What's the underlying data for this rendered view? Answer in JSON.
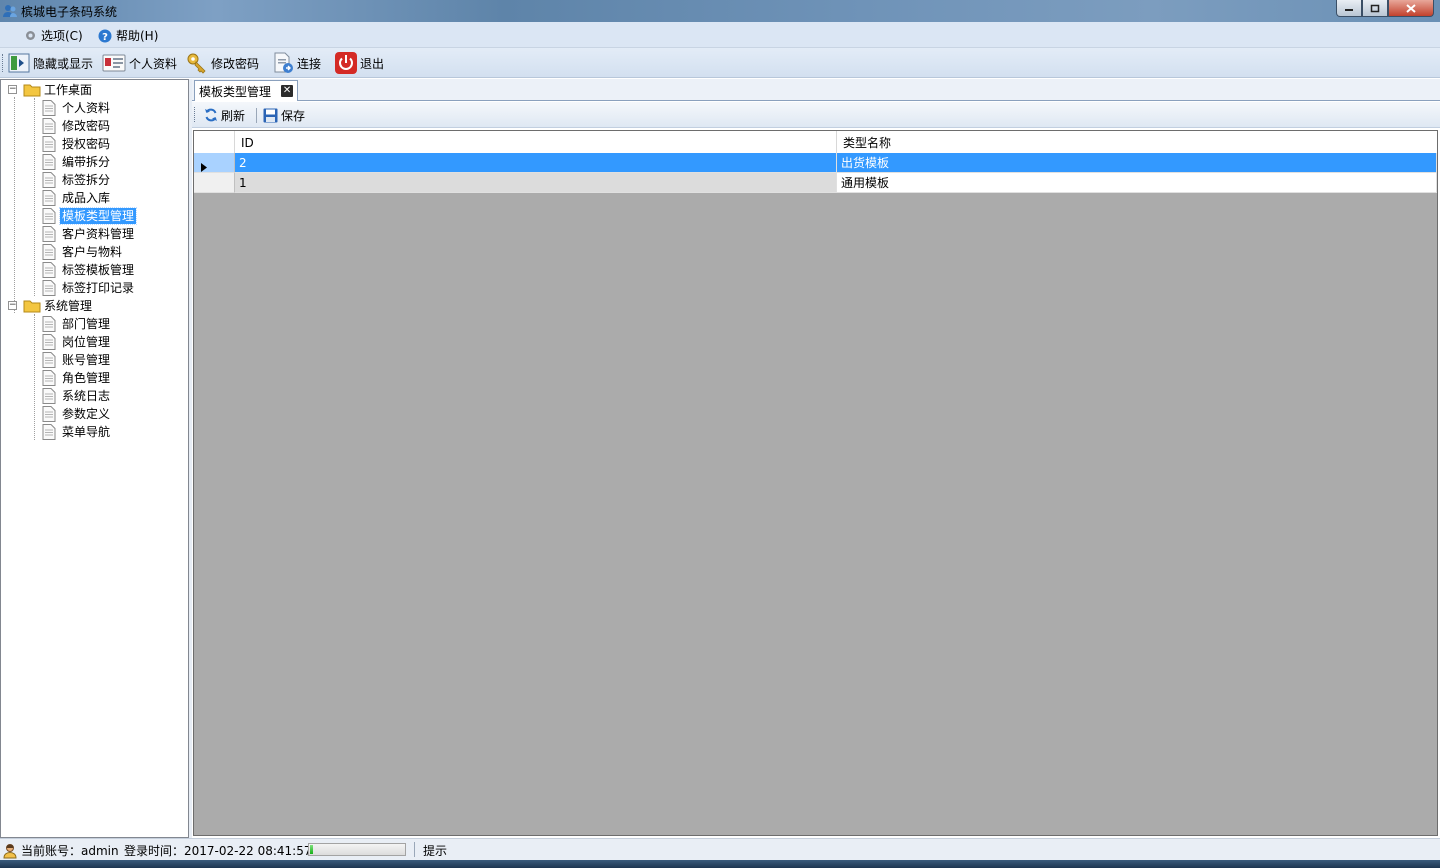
{
  "window": {
    "title": "槟城电子条码系统",
    "controls": [
      "minimize",
      "maximize",
      "close"
    ]
  },
  "menu": {
    "options": "选项(C)",
    "help": "帮助(H)"
  },
  "toolbar": {
    "toggle": "隐藏或显示",
    "profile": "个人资料",
    "change_password": "修改密码",
    "connect": "连接",
    "exit": "退出"
  },
  "tree": {
    "groups": [
      {
        "label": "工作桌面",
        "items": [
          "个人资料",
          "修改密码",
          "授权密码",
          "编带拆分",
          "标签拆分",
          "成品入库",
          "模板类型管理",
          "客户资料管理",
          "客户与物料",
          "标签模板管理",
          "标签打印记录"
        ]
      },
      {
        "label": "系统管理",
        "items": [
          "部门管理",
          "岗位管理",
          "账号管理",
          "角色管理",
          "系统日志",
          "参数定义",
          "菜单导航"
        ]
      }
    ],
    "selected": "模板类型管理"
  },
  "tab": {
    "title": "模板类型管理"
  },
  "content_toolbar": {
    "refresh": "刷新",
    "save": "保存"
  },
  "grid": {
    "columns": [
      "ID",
      "类型名称"
    ],
    "rows": [
      {
        "id": "2",
        "name": "出货模板",
        "selected": true
      },
      {
        "id": "1",
        "name": "通用模板",
        "selected": false
      }
    ]
  },
  "status": {
    "account_label": "当前账号：",
    "account": "admin",
    "login_label": "登录时间：",
    "login_time": "2017-02-22 08:41:57",
    "progress": 0.03,
    "hint": "提示"
  },
  "colors": {
    "selection": "#3399ff",
    "grid_background": "#ababab",
    "toolbar_bg": "#dbe6f4"
  }
}
